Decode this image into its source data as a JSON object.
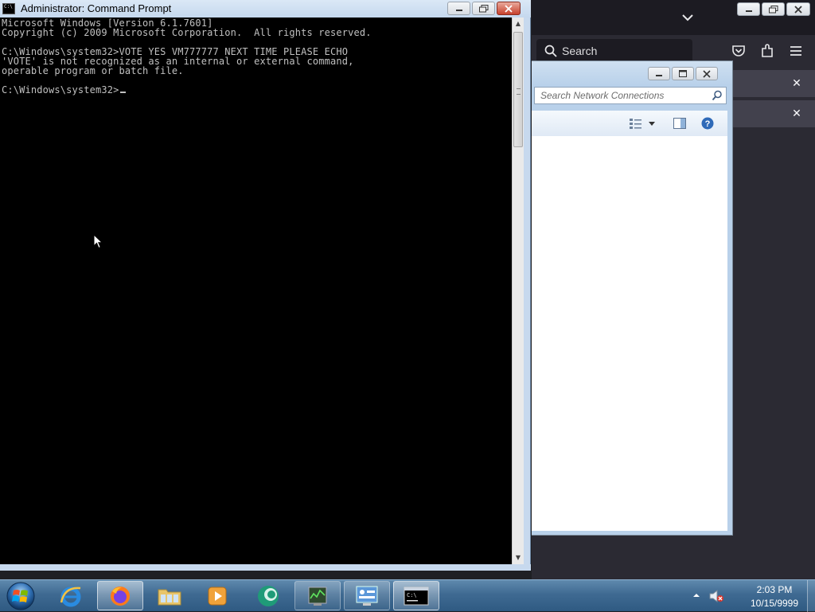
{
  "cmd": {
    "title": "Administrator: Command Prompt",
    "icon_text": "C:\\",
    "lines": [
      "Microsoft Windows [Version 6.1.7601]",
      "Copyright (c) 2009 Microsoft Corporation.  All rights reserved.",
      "",
      "C:\\Windows\\system32>VOTE YES VM777777 NEXT TIME PLEASE ECHO",
      "'VOTE' is not recognized as an internal or external command,",
      "operable program or batch file.",
      "",
      "C:\\Windows\\system32>"
    ]
  },
  "firefox": {
    "search_label": "Search"
  },
  "network_connections": {
    "search_placeholder": "Search Network Connections"
  },
  "taskbar": {
    "items": [
      "Internet Explorer",
      "Firefox",
      "Windows Explorer",
      "Windows Media Player",
      "App",
      "Task Manager",
      "Control Panel",
      "Command Prompt"
    ]
  },
  "clock": {
    "time": "2:03 PM",
    "date": "10/15/9999"
  },
  "colors": {
    "console_bg": "#000000",
    "console_fg": "#c0c0c0",
    "firefox_bg": "#2b2a33",
    "taskbar": "#3f6a92"
  }
}
